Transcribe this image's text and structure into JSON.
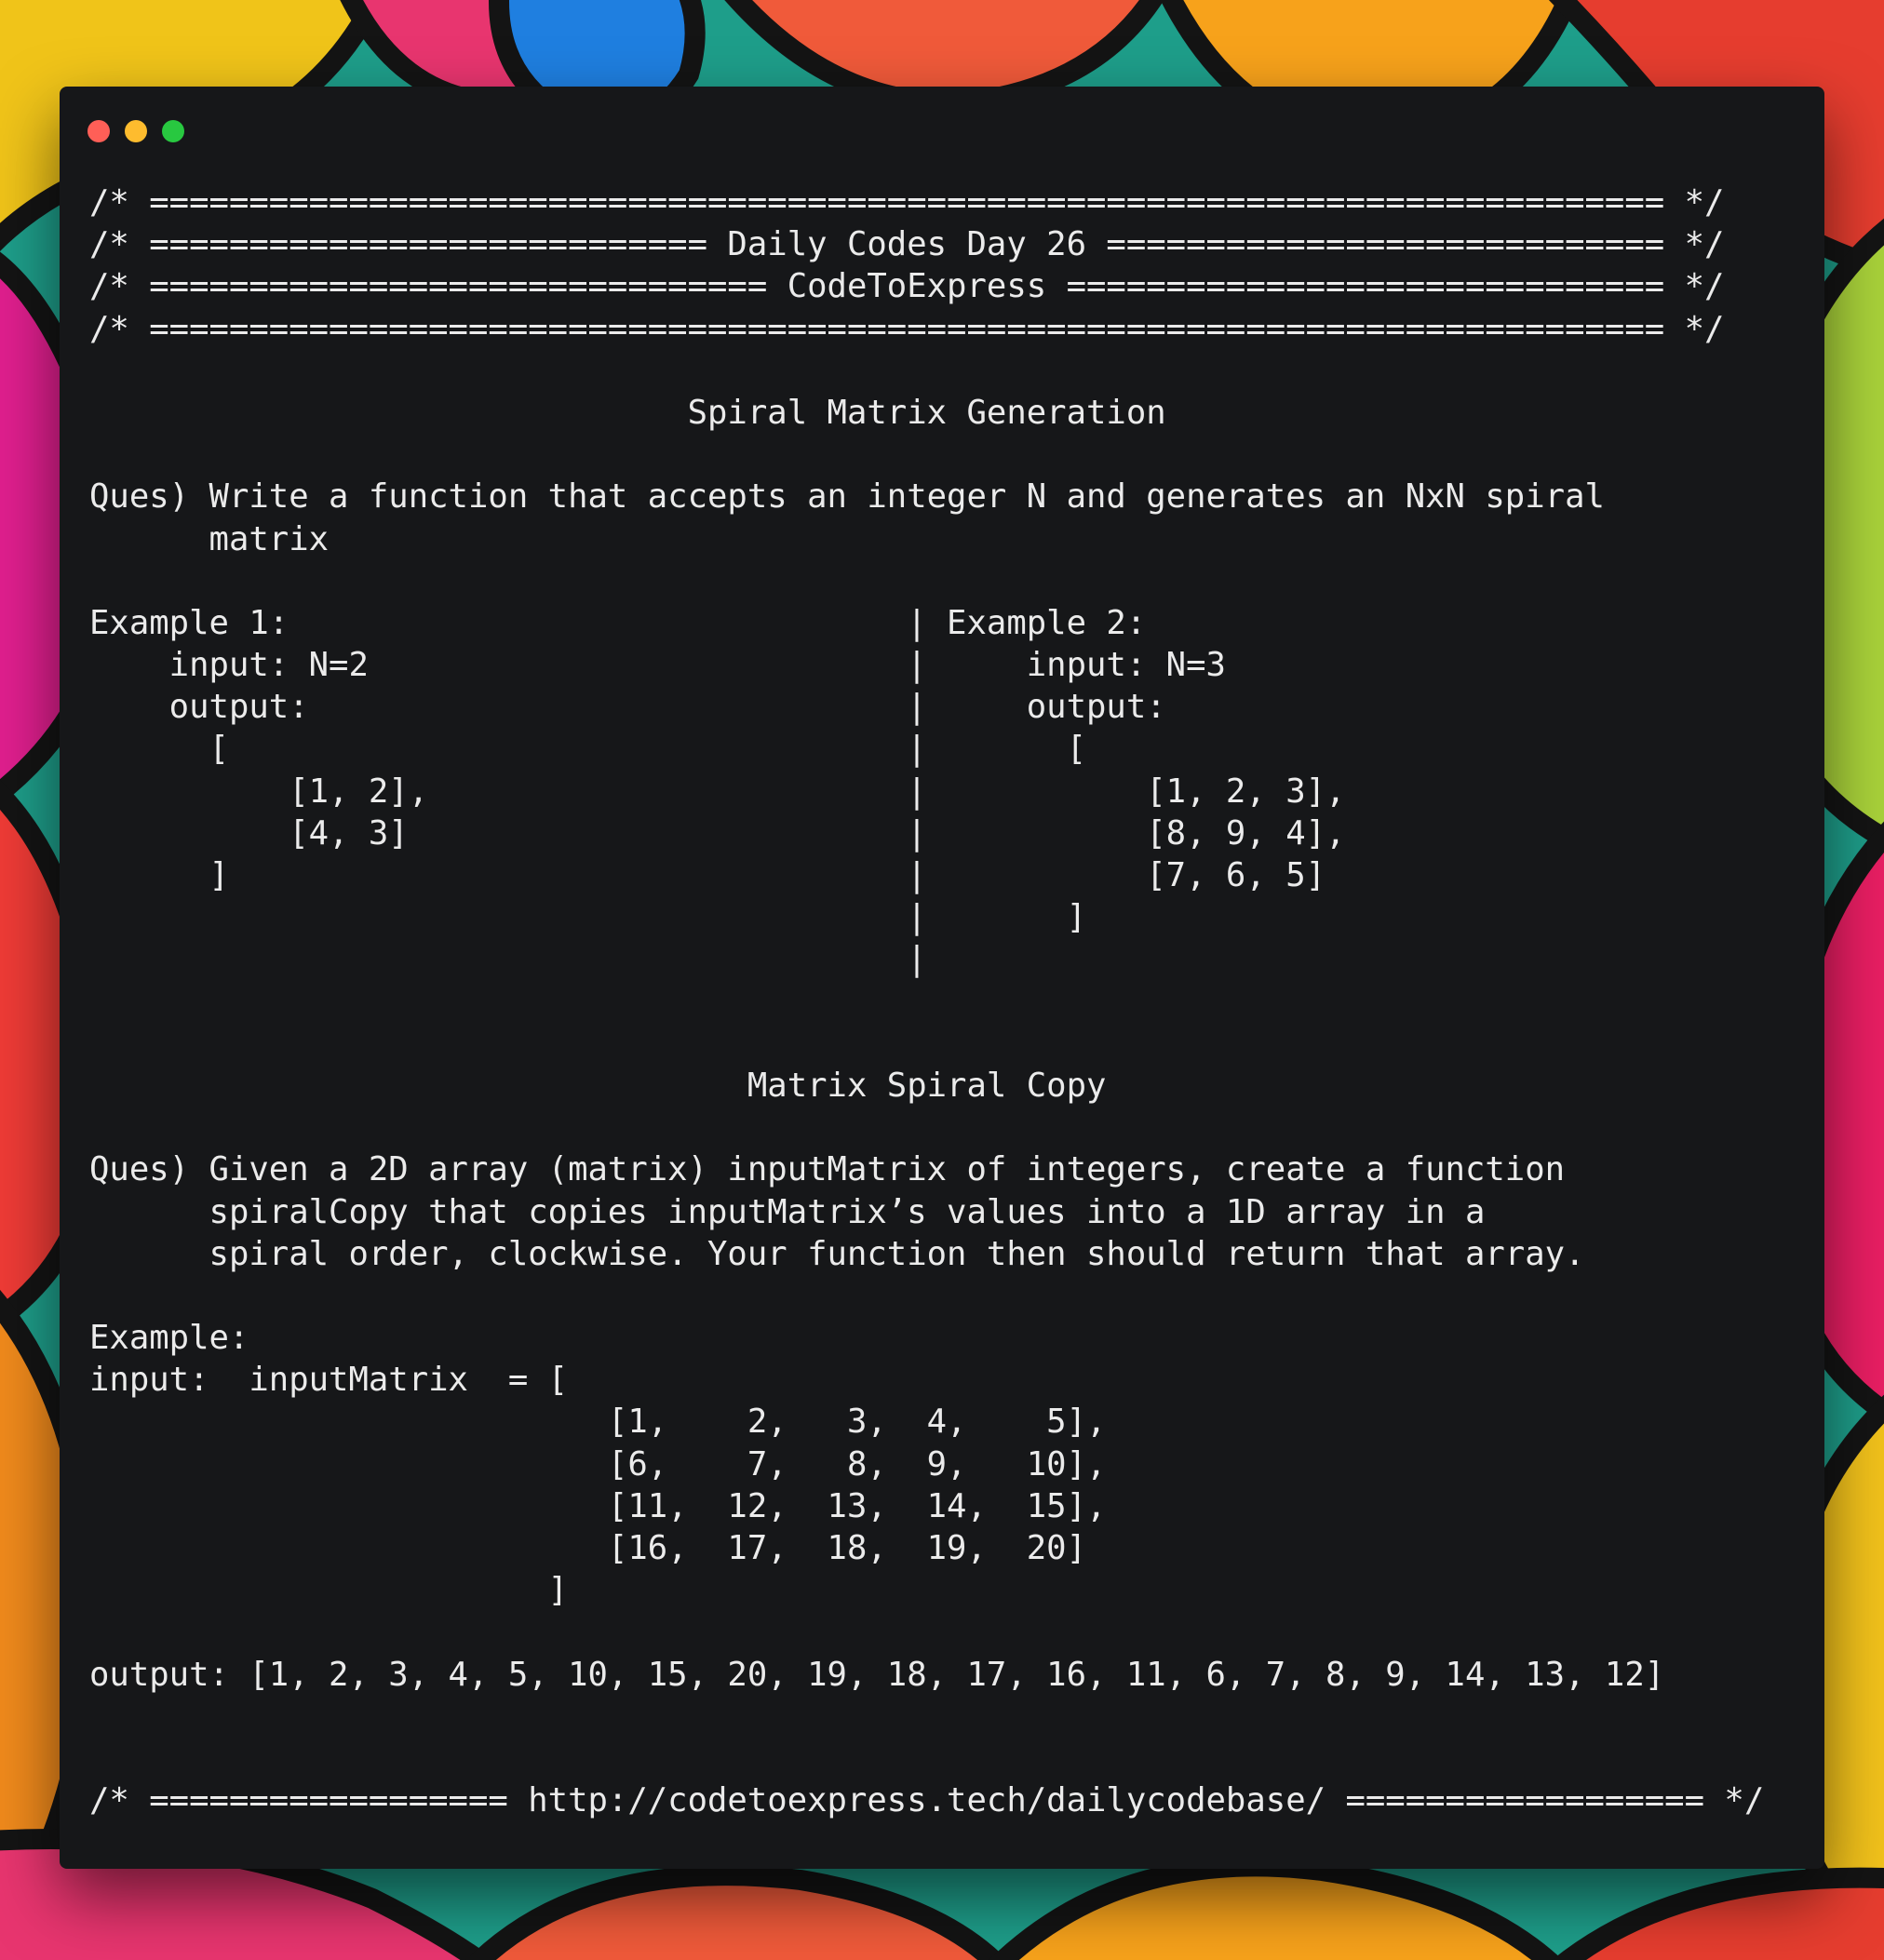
{
  "window": {
    "controls": {
      "close_color": "#ff5f57",
      "minimize_color": "#febc2e",
      "zoom_color": "#28c840"
    }
  },
  "code_lines": [
    "/* ============================================================================ */",
    "/* ============================ Daily Codes Day 26 ============================ */",
    "/* =============================== CodeToExpress ============================== */",
    "/* ============================================================================ */",
    "",
    "                              Spiral Matrix Generation",
    "",
    "Ques) Write a function that accepts an integer N and generates an NxN spiral",
    "      matrix",
    "",
    "Example 1:                               | Example 2:",
    "    input: N=2                           |     input: N=3",
    "    output:                              |     output:",
    "      [                                  |       [",
    "          [1, 2],                        |           [1, 2, 3],",
    "          [4, 3]                         |           [8, 9, 4],",
    "      ]                                  |           [7, 6, 5]",
    "                                         |       ]",
    "                                         |",
    "",
    "",
    "                                 Matrix Spiral Copy",
    "",
    "Ques) Given a 2D array (matrix) inputMatrix of integers, create a function",
    "      spiralCopy that copies inputMatrix’s values into a 1D array in a",
    "      spiral order, clockwise. Your function then should return that array.",
    "",
    "Example:",
    "input:  inputMatrix  = [",
    "                          [1,    2,   3,  4,    5],",
    "                          [6,    7,   8,  9,   10],",
    "                          [11,  12,  13,  14,  15],",
    "                          [16,  17,  18,  19,  20]",
    "                       ]",
    "",
    "output: [1, 2, 3, 4, 5, 10, 15, 20, 19, 18, 17, 16, 11, 6, 7, 8, 9, 14, 13, 12]",
    "",
    "",
    "/* ================== http://codetoexpress.tech/dailycodebase/ ================== */"
  ]
}
